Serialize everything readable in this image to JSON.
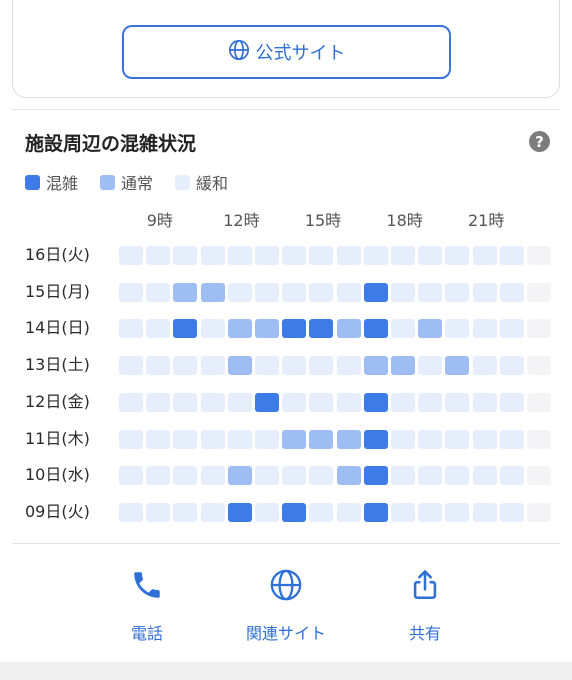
{
  "top": {
    "snippet": "",
    "official_site_label": "公式サイト"
  },
  "congestion": {
    "title": "施設周辺の混雑状況",
    "help_label": "?",
    "legend": [
      {
        "label": "混雑",
        "color": "#3d7be6"
      },
      {
        "label": "通常",
        "color": "#9ebdf2"
      },
      {
        "label": "緩和",
        "color": "#e6eefc"
      }
    ],
    "hour_labels": [
      "9時",
      "12時",
      "15時",
      "18時",
      "21時"
    ],
    "empty_color": "#f4f4f6",
    "days": [
      {
        "label": "16日(火)",
        "levels": [
          1,
          1,
          1,
          1,
          1,
          1,
          1,
          1,
          1,
          1,
          1,
          1,
          1,
          1,
          1,
          0
        ]
      },
      {
        "label": "15日(月)",
        "levels": [
          1,
          1,
          2,
          2,
          1,
          1,
          1,
          1,
          1,
          3,
          1,
          1,
          1,
          1,
          1,
          0
        ]
      },
      {
        "label": "14日(日)",
        "levels": [
          1,
          1,
          3,
          1,
          2,
          2,
          3,
          3,
          2,
          3,
          1,
          2,
          1,
          1,
          1,
          0
        ]
      },
      {
        "label": "13日(土)",
        "levels": [
          1,
          1,
          1,
          1,
          2,
          1,
          1,
          1,
          1,
          2,
          2,
          1,
          2,
          1,
          1,
          0
        ]
      },
      {
        "label": "12日(金)",
        "levels": [
          1,
          1,
          1,
          1,
          1,
          3,
          1,
          1,
          1,
          3,
          1,
          1,
          1,
          1,
          1,
          0
        ]
      },
      {
        "label": "11日(木)",
        "levels": [
          1,
          1,
          1,
          1,
          1,
          1,
          2,
          2,
          2,
          3,
          1,
          1,
          1,
          1,
          1,
          0
        ]
      },
      {
        "label": "10日(水)",
        "levels": [
          1,
          1,
          1,
          1,
          2,
          1,
          1,
          1,
          2,
          3,
          1,
          1,
          1,
          1,
          1,
          0
        ]
      },
      {
        "label": "09日(火)",
        "levels": [
          1,
          1,
          1,
          1,
          3,
          1,
          3,
          1,
          1,
          3,
          1,
          1,
          1,
          1,
          1,
          0
        ]
      }
    ]
  },
  "actions": [
    {
      "label": "電話",
      "icon": "phone-icon"
    },
    {
      "label": "関連サイト",
      "icon": "globe-icon"
    },
    {
      "label": "共有",
      "icon": "share-icon"
    }
  ]
}
